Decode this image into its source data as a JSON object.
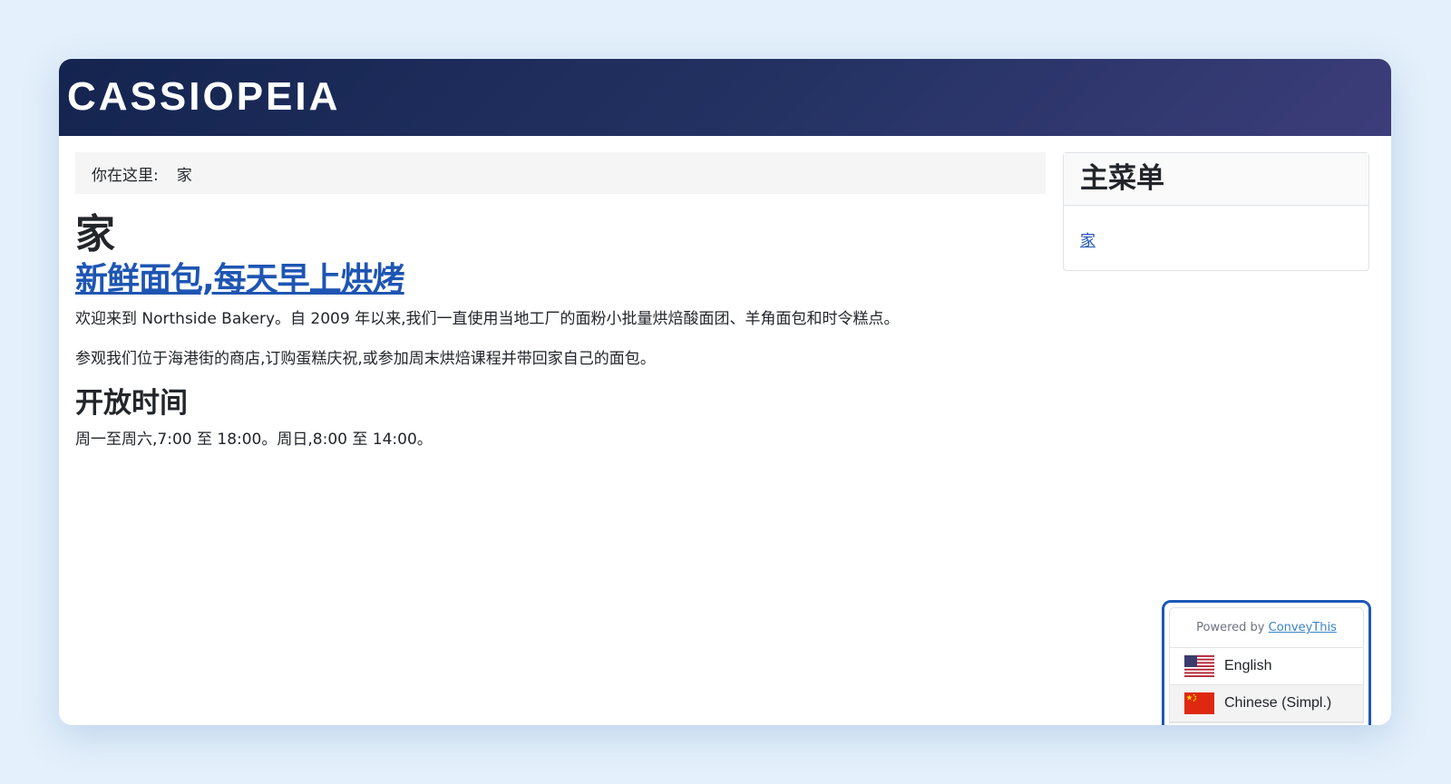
{
  "header": {
    "brand": "CASSIOPEIA"
  },
  "breadcrumb": {
    "label": "你在这里:",
    "current": "家"
  },
  "main": {
    "page_heading": "家",
    "article_title": "新鲜面包,每天早上烘烤",
    "paragraphs": [
      "欢迎来到 Northside Bakery。自 2009 年以来,我们一直使用当地工厂的面粉小批量烘焙酸面团、羊角面包和时令糕点。",
      "参观我们位于海港街的商店,订购蛋糕庆祝,或参加周末烘焙课程并带回家自己的面包。"
    ],
    "hours_heading": "开放时间",
    "hours_text": "周一至周六,7:00 至 18:00。周日,8:00 至 14:00。"
  },
  "sidebar": {
    "title": "主菜单",
    "items": [
      {
        "label": "家"
      }
    ]
  },
  "language_widget": {
    "powered_by": "Powered by",
    "provider": "ConveyThis",
    "languages": [
      {
        "label": "English",
        "flag": "us-flag-icon"
      },
      {
        "label": "Chinese (Simpl.)",
        "flag": "cn-flag-icon",
        "selected": true
      }
    ]
  },
  "colors": {
    "header_gradient_start": "#14244f",
    "header_gradient_end": "#3c3d7a",
    "link": "#1e55b3",
    "widget_border": "#1d58b8",
    "page_background": "#e4f0fb"
  }
}
